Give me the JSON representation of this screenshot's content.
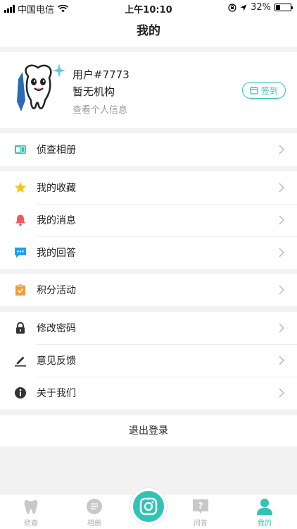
{
  "status_bar": {
    "carrier": "中国电信",
    "time": "上午10:10",
    "battery": "32%",
    "battery_level": 0.32
  },
  "header": {
    "title": "我的"
  },
  "profile": {
    "username": "用户#7773",
    "organization": "暂无机构",
    "view_info": "查看个人信息",
    "signin_label": "签到"
  },
  "menu_groups": [
    [
      {
        "label": "侦查相册",
        "icon": "photo-album-icon",
        "color": "#2fc4b5"
      }
    ],
    [
      {
        "label": "我的收藏",
        "icon": "star-icon",
        "color": "#f5c518"
      },
      {
        "label": "我的消息",
        "icon": "bell-icon",
        "color": "#f15a5a"
      },
      {
        "label": "我的回答",
        "icon": "chat-bubble-icon",
        "color": "#1da1f2"
      }
    ],
    [
      {
        "label": "积分活动",
        "icon": "clipboard-check-icon",
        "color": "#f29c38"
      }
    ],
    [
      {
        "label": "修改密码",
        "icon": "lock-icon",
        "color": "#333333"
      },
      {
        "label": "意见反馈",
        "icon": "pencil-icon",
        "color": "#333333"
      },
      {
        "label": "关于我们",
        "icon": "info-icon",
        "color": "#333333"
      }
    ]
  ],
  "logout": {
    "label": "退出登录"
  },
  "tabbar": {
    "items": [
      {
        "label": "侦查",
        "icon": "tooth-icon"
      },
      {
        "label": "相册",
        "icon": "list-icon"
      },
      {
        "label": "",
        "icon": "camera-icon"
      },
      {
        "label": "问答",
        "icon": "question-icon"
      },
      {
        "label": "我的",
        "icon": "person-icon"
      }
    ],
    "active": "我的"
  },
  "colors": {
    "accent": "#2fc4b5",
    "background": "#f2f2f2"
  }
}
